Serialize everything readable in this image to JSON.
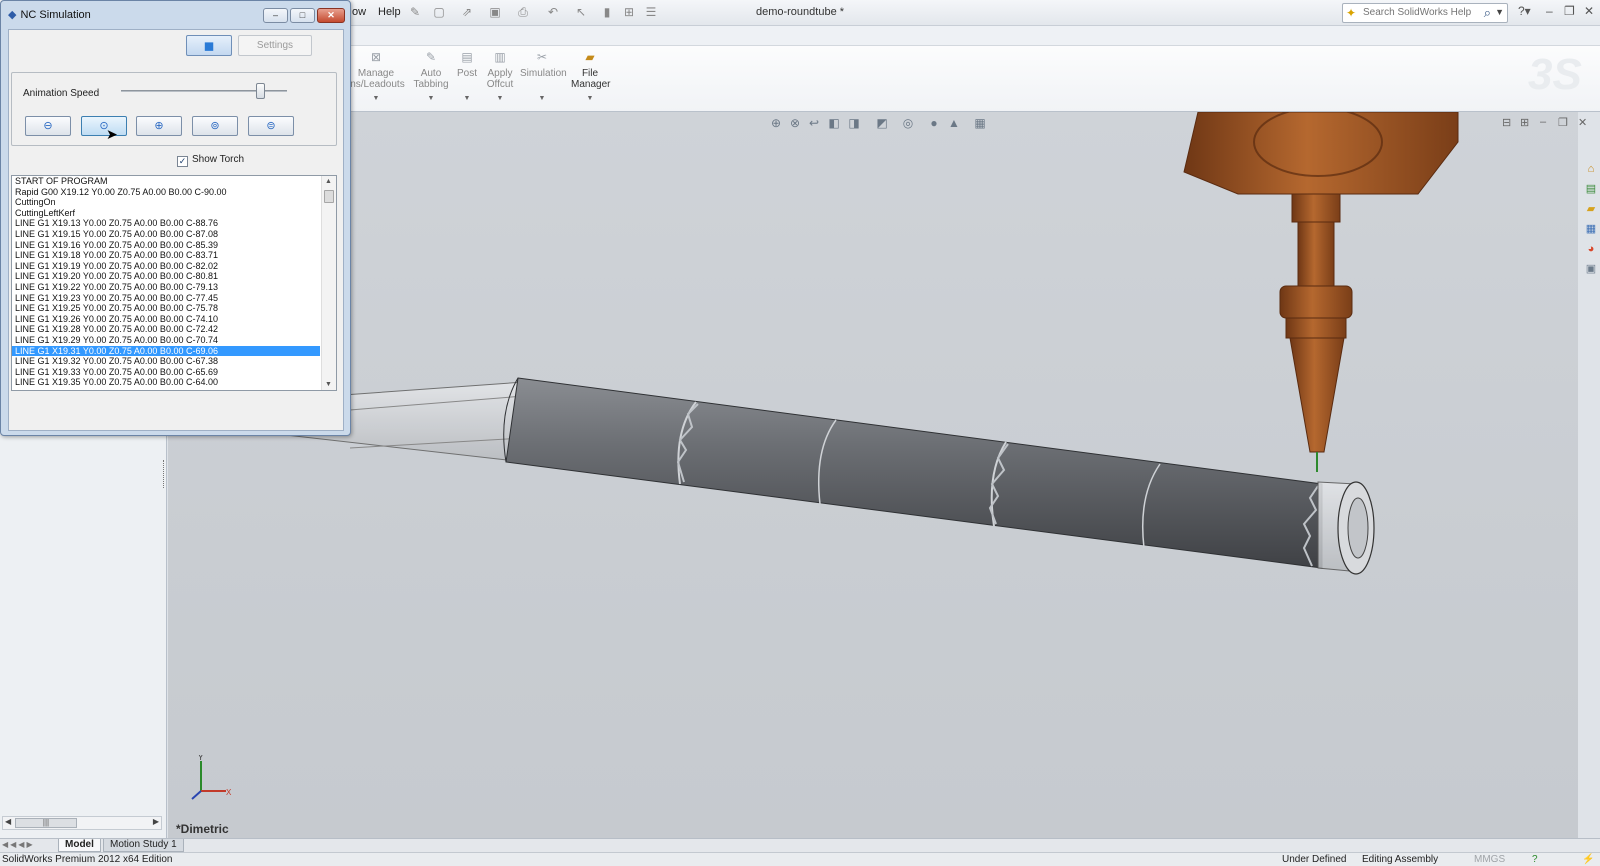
{
  "app": {
    "document_title": "demo-roundtube *",
    "menu": [
      "ow",
      "Help"
    ],
    "search_placeholder": "Search SolidWorks Help"
  },
  "ribbon": {
    "commands": [
      {
        "label_line1": "Manage",
        "label_line2": "ins/Leadouts",
        "enabled": false
      },
      {
        "label_line1": "Auto",
        "label_line2": "Tabbing",
        "enabled": false
      },
      {
        "label_line1": "Post",
        "label_line2": "",
        "enabled": false
      },
      {
        "label_line1": "Apply",
        "label_line2": "Offcut",
        "enabled": false
      },
      {
        "label_line1": "Simulation",
        "label_line2": "",
        "enabled": false
      },
      {
        "label_line1": "File",
        "label_line2": "Manager",
        "enabled": true
      }
    ]
  },
  "dialog": {
    "title": "NC Simulation",
    "settings_label": "Settings",
    "animation_speed_label": "Animation Speed",
    "animation_speed_fraction": 0.84,
    "show_torch_label": "Show Torch",
    "show_torch_checked": true,
    "nc_program": [
      "START OF PROGRAM",
      "Rapid G00 X19.12 Y0.00 Z0.75 A0.00 B0.00 C-90.00",
      "CuttingOn",
      "CuttingLeftKerf",
      "LINE G1 X19.13 Y0.00 Z0.75 A0.00 B0.00 C-88.76",
      "LINE G1 X19.15 Y0.00 Z0.75 A0.00 B0.00 C-87.08",
      "LINE G1 X19.16 Y0.00 Z0.75 A0.00 B0.00 C-85.39",
      "LINE G1 X19.18 Y0.00 Z0.75 A0.00 B0.00 C-83.71",
      "LINE G1 X19.19 Y0.00 Z0.75 A0.00 B0.00 C-82.02",
      "LINE G1 X19.20 Y0.00 Z0.75 A0.00 B0.00 C-80.81",
      "LINE G1 X19.22 Y0.00 Z0.75 A0.00 B0.00 C-79.13",
      "LINE G1 X19.23 Y0.00 Z0.75 A0.00 B0.00 C-77.45",
      "LINE G1 X19.25 Y0.00 Z0.75 A0.00 B0.00 C-75.78",
      "LINE G1 X19.26 Y0.00 Z0.75 A0.00 B0.00 C-74.10",
      "LINE G1 X19.28 Y0.00 Z0.75 A0.00 B0.00 C-72.42",
      "LINE G1 X19.29 Y0.00 Z0.75 A0.00 B0.00 C-70.74",
      "LINE G1 X19.31 Y0.00 Z0.75 A0.00 B0.00 C-69.06",
      "LINE G1 X19.32 Y0.00 Z0.75 A0.00 B0.00 C-67.38",
      "LINE G1 X19.33 Y0.00 Z0.75 A0.00 B0.00 C-65.69",
      "LINE G1 X19.35 Y0.00 Z0.75 A0.00 B0.00 C-64.00"
    ],
    "selected_index": 16
  },
  "viewport": {
    "view_orientation": "*Dimetric",
    "triad_y": "Y",
    "triad_x": "X"
  },
  "tabs": [
    "Model",
    "Motion Study 1"
  ],
  "statusbar": {
    "edition": "SolidWorks Premium 2012 x64 Edition",
    "state": "Under Defined",
    "mode": "Editing Assembly",
    "units": "MMGS"
  },
  "colors": {
    "selection": "#3399ff",
    "torch": "#a65a2a",
    "tube": "#5e6166"
  },
  "icons": {
    "dialog": "nc-sim-icon",
    "cube": "cube-icon",
    "rewind": "rewind-icon",
    "play": "play-icon",
    "pause": "pause-icon",
    "stop": "stop-icon",
    "forward": "forward-icon"
  }
}
